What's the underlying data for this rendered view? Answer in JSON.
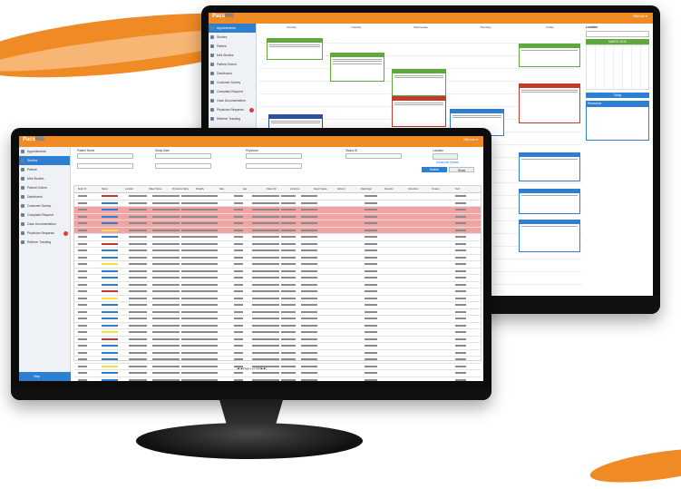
{
  "app": {
    "name_prefix": "Pacs",
    "name_suffix": "RIS",
    "brand_color": "#f08a24",
    "accent_color": "#2f7fd0",
    "highlight_row_color": "#f4a3a3"
  },
  "back_monitor": {
    "user_label": "Sllirinin ▾",
    "sidebar": [
      {
        "label": "Appointments",
        "active": true
      },
      {
        "label": "Studies"
      },
      {
        "label": "Patient"
      },
      {
        "label": "Mini Studies"
      },
      {
        "label": "Patient Orders"
      },
      {
        "label": "Dashboard"
      },
      {
        "label": "Customer Survey"
      },
      {
        "label": "Complaint Request"
      },
      {
        "label": "Case Documentation"
      },
      {
        "label": "Physician Requests",
        "badge": true
      },
      {
        "label": "Referrer Tracking"
      }
    ],
    "calendar_days": [
      "Monday",
      "Tuesday",
      "Wednesday",
      "Thursday",
      "Friday"
    ],
    "right_panel": {
      "title": "Location",
      "month": "MARCH 2016",
      "today_button": "Today",
      "resources_title": "Resources"
    }
  },
  "front_monitor": {
    "user_label": "Sllirinin ▾",
    "sidebar": [
      {
        "label": "Appointments"
      },
      {
        "label": "Studies",
        "active": true
      },
      {
        "label": "Patient"
      },
      {
        "label": "Mini Studies"
      },
      {
        "label": "Patient Orders"
      },
      {
        "label": "Dashboard"
      },
      {
        "label": "Customer Survey"
      },
      {
        "label": "Complaint Request"
      },
      {
        "label": "Case Documentation"
      },
      {
        "label": "Physician Requests",
        "badge": true
      },
      {
        "label": "Referrer Tracking"
      }
    ],
    "filters": {
      "patient_name": "Patient Name",
      "study_date": "Study Date",
      "physician": "Physician",
      "status": "Status ID",
      "location": "Location"
    },
    "buttons": {
      "search": "Search",
      "reset": "Reset",
      "advanced": "Advanced Search"
    },
    "table_header": [
      "Study ID",
      "Status",
      "Location",
      "Patient Name",
      "Procedure Name",
      "Modality",
      "Date",
      "Age",
      "Patient ID",
      "Insurance",
      "Report Status",
      "Referrer",
      "Radiologist",
      "Remarks",
      "Scheduled",
      "Created",
      "Tech"
    ],
    "pager": "|◀ ◀  Page 1 of 120  ▶ ▶|",
    "footer_help": "Help"
  }
}
